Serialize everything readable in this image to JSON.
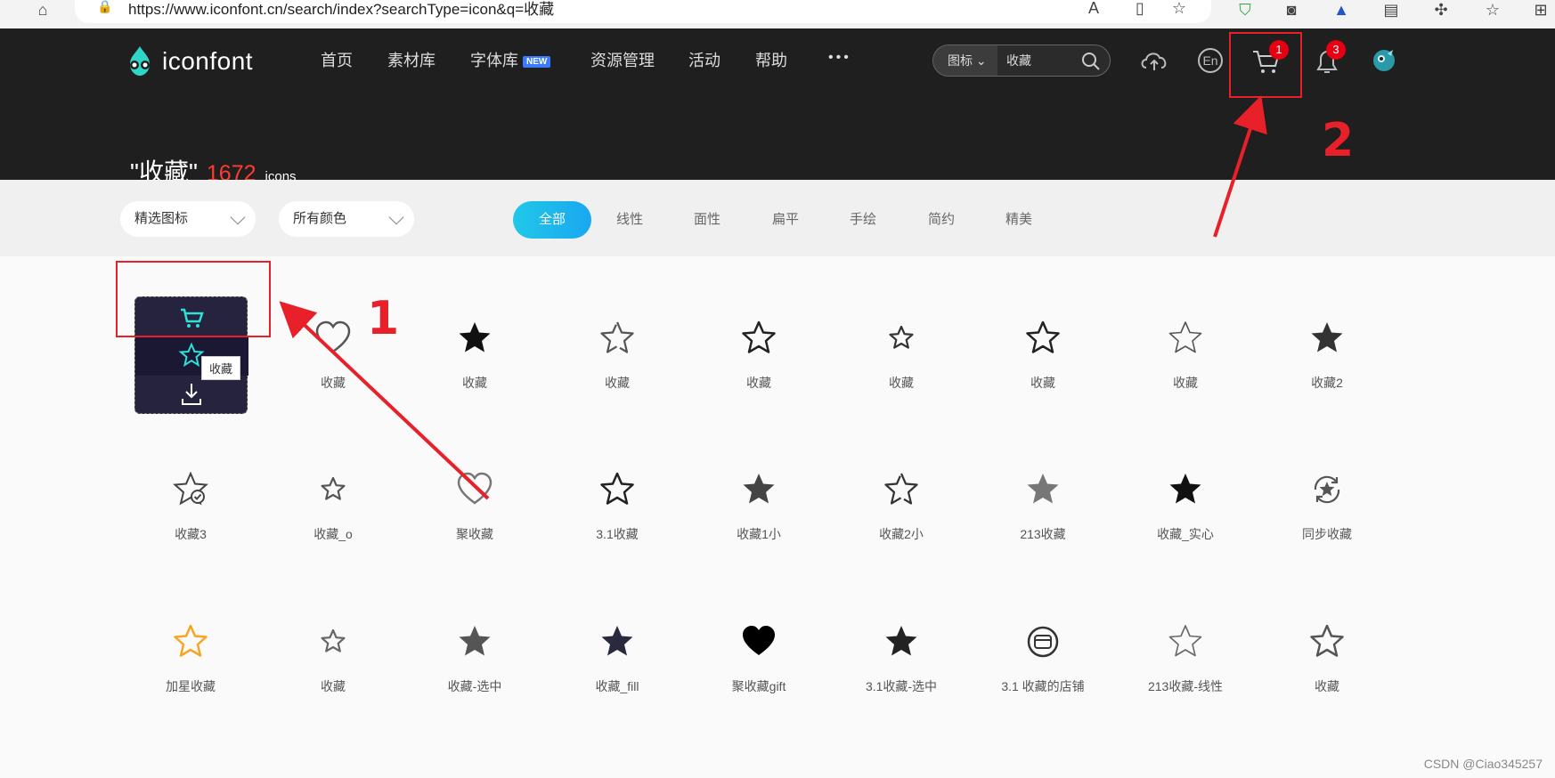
{
  "browser": {
    "url": "https://www.iconfont.cn/search/index?searchType=icon&q=收藏"
  },
  "header": {
    "logo_text": "iconfont",
    "nav": [
      "首页",
      "素材库",
      "字体库",
      "资源管理",
      "活动",
      "帮助"
    ],
    "new_badge": "NEW",
    "more": "•••",
    "search_type": "图标",
    "search_value": "收藏",
    "lang": "En",
    "cart_count": "1",
    "notify_count": "3"
  },
  "result": {
    "query": "\"收藏\"",
    "count": "1672",
    "unit": "icons"
  },
  "filters": {
    "dropdown1": "精选图标",
    "dropdown2": "所有颜色",
    "tabs": [
      "全部",
      "线性",
      "面性",
      "扁平",
      "手绘",
      "简约",
      "精美"
    ]
  },
  "icons": [
    {
      "label": "收藏",
      "shape": "heart-outline",
      "color": "#555555"
    },
    {
      "label": "收藏",
      "shape": "star-filled",
      "color": "#111111"
    },
    {
      "label": "收藏",
      "shape": "star-outline-hand",
      "color": "#555555"
    },
    {
      "label": "收藏",
      "shape": "star-outline",
      "color": "#222222"
    },
    {
      "label": "收藏",
      "shape": "star-outline-small",
      "color": "#333333"
    },
    {
      "label": "收藏",
      "shape": "star-outline",
      "color": "#222222"
    },
    {
      "label": "收藏",
      "shape": "star-outline-thin",
      "color": "#555555"
    },
    {
      "label": "收藏2",
      "shape": "star-filled",
      "color": "#333333"
    },
    {
      "label": "收藏3",
      "shape": "star-check",
      "color": "#444444"
    },
    {
      "label": "收藏_o",
      "shape": "star-outline-small",
      "color": "#555555"
    },
    {
      "label": "聚收藏",
      "shape": "heart-outline",
      "color": "#777777"
    },
    {
      "label": "3.1收藏",
      "shape": "star-outline",
      "color": "#222222"
    },
    {
      "label": "收藏1小",
      "shape": "star-filled",
      "color": "#444444"
    },
    {
      "label": "收藏2小",
      "shape": "star-outline-hand",
      "color": "#333333"
    },
    {
      "label": "213收藏",
      "shape": "star-filled",
      "color": "#777777"
    },
    {
      "label": "收藏_实心",
      "shape": "star-filled",
      "color": "#111111"
    },
    {
      "label": "同步收藏",
      "shape": "star-sync",
      "color": "#555555"
    },
    {
      "label": "加星收藏",
      "shape": "star-outline",
      "color": "#f5a623"
    },
    {
      "label": "收藏",
      "shape": "star-outline-small",
      "color": "#666666"
    },
    {
      "label": "收藏-选中",
      "shape": "star-filled",
      "color": "#555555"
    },
    {
      "label": "收藏_fill",
      "shape": "star-filled",
      "color": "#2a2a3e"
    },
    {
      "label": "聚收藏gift",
      "shape": "heart-filled",
      "color": "#000000"
    },
    {
      "label": "3.1收藏-选中",
      "shape": "star-filled",
      "color": "#222222"
    },
    {
      "label": "3.1 收藏的店铺",
      "shape": "shop-circle",
      "color": "#333333"
    },
    {
      "label": "213收藏-线性",
      "shape": "star-outline-thin",
      "color": "#666666"
    },
    {
      "label": "收藏",
      "shape": "star-outline",
      "color": "#555555"
    }
  ],
  "hover_card": {
    "tooltip": "收藏"
  },
  "annotations": {
    "one": "1",
    "two": "2"
  },
  "watermark": "CSDN @Ciao345257",
  "colors": {
    "accent": "#20c8e8",
    "header_bg": "#1f1f1f",
    "annotation_red": "#e8202a"
  }
}
